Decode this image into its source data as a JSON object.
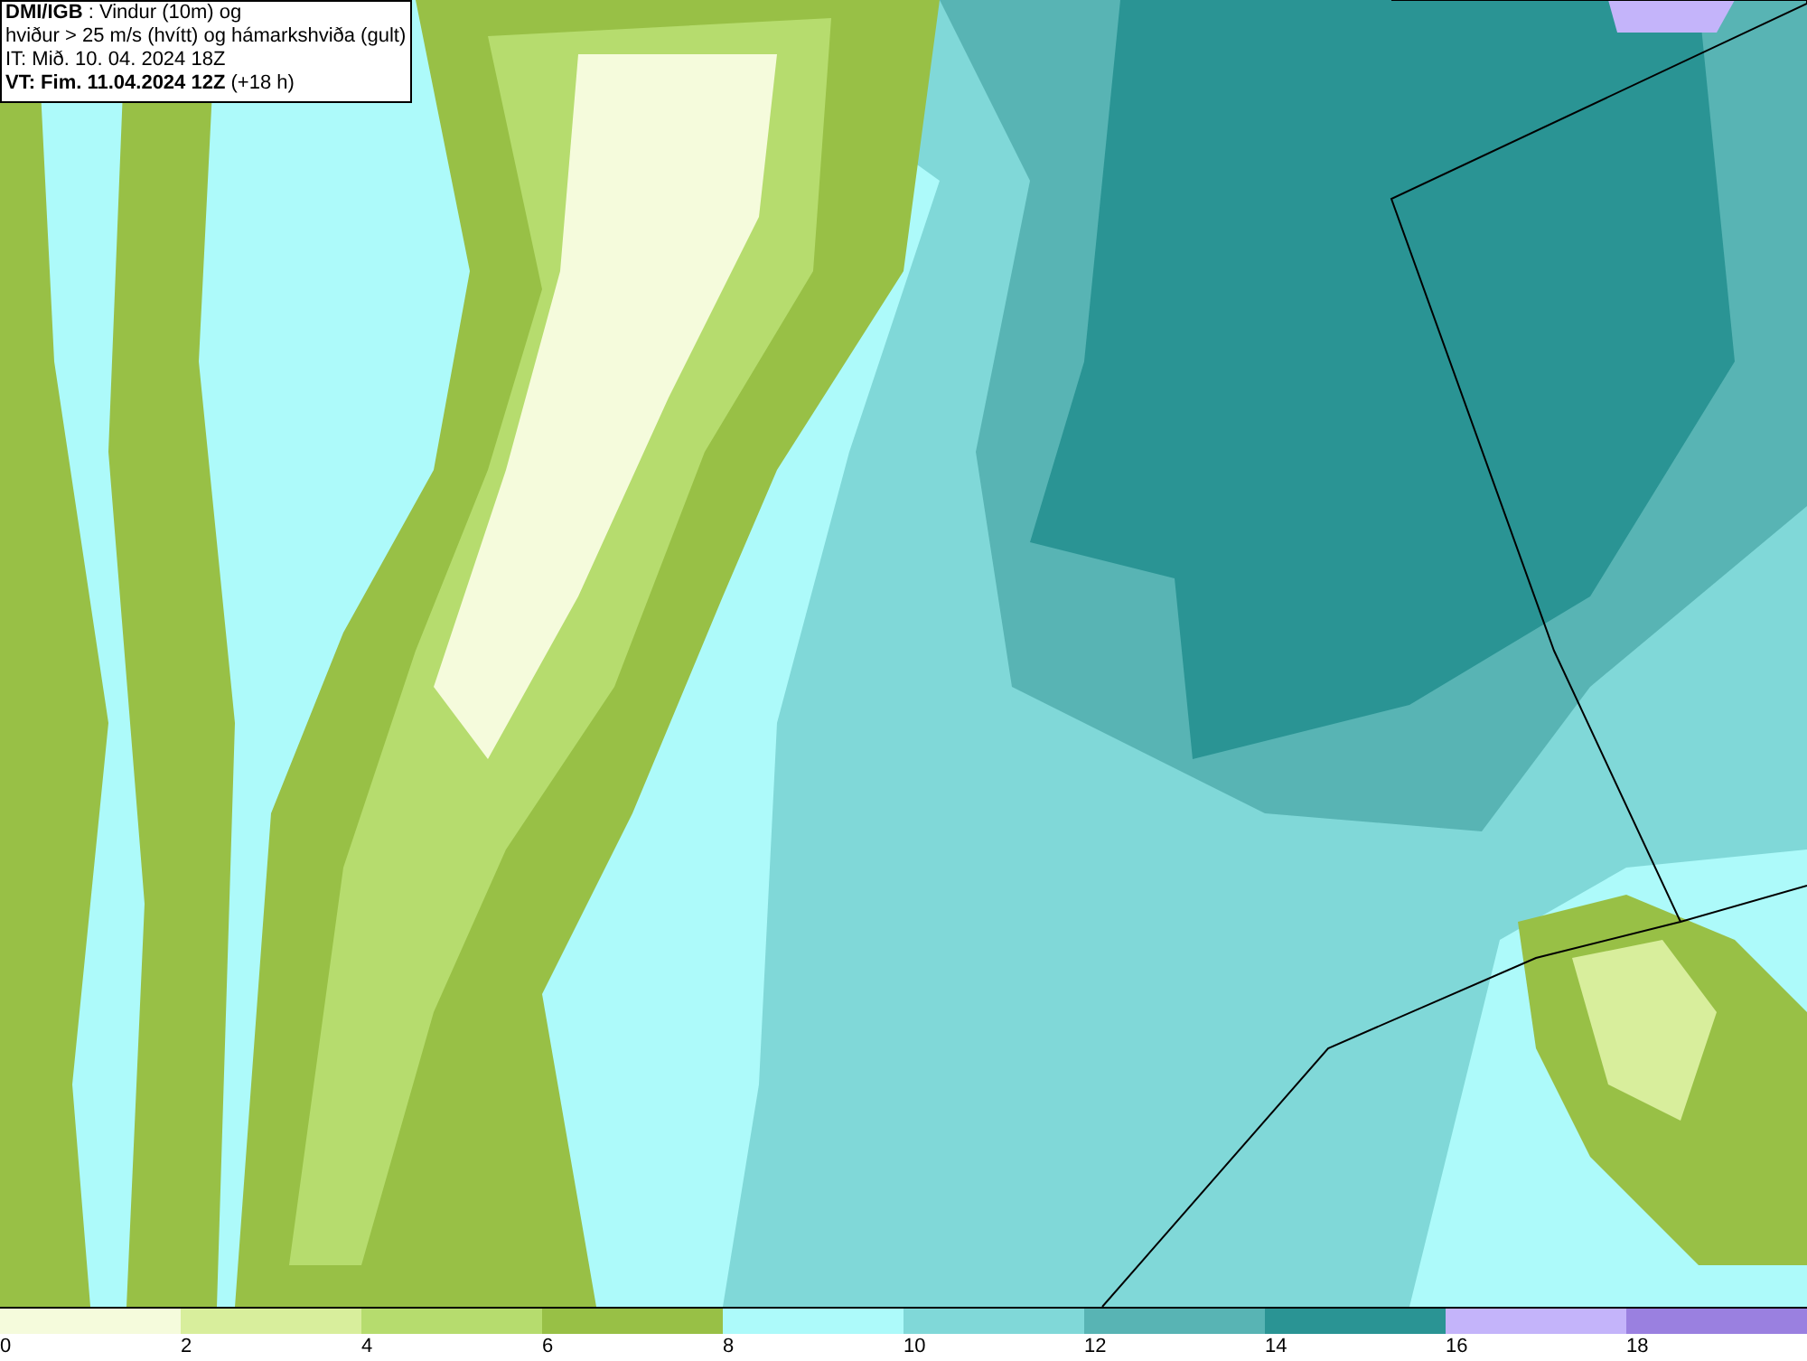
{
  "header": {
    "lines": [
      "**DMI/IGB** : Vindur (10m) og",
      "hviður > 25 m/s (hvítt) og hámarkshviða (gult)",
      "IT: Mið. 10. 04. 2024 18Z",
      "**VT: Fim. 11.04.2024 12Z** (+18 h)"
    ]
  },
  "legend": [
    {
      "label": "0",
      "color": "#f5fbdc"
    },
    {
      "label": "2",
      "color": "#d8ee9c"
    },
    {
      "label": "4",
      "color": "#b6dc6e"
    },
    {
      "label": "6",
      "color": "#98c046"
    },
    {
      "label": "8",
      "color": "#adfafa"
    },
    {
      "label": "10",
      "color": "#80d8d8"
    },
    {
      "label": "12",
      "color": "#58b4b4"
    },
    {
      "label": "14",
      "color": "#2a9494"
    },
    {
      "label": "16",
      "color": "#c4b4fa"
    },
    {
      "label": "18",
      "color": "#9a80e0"
    }
  ]
}
